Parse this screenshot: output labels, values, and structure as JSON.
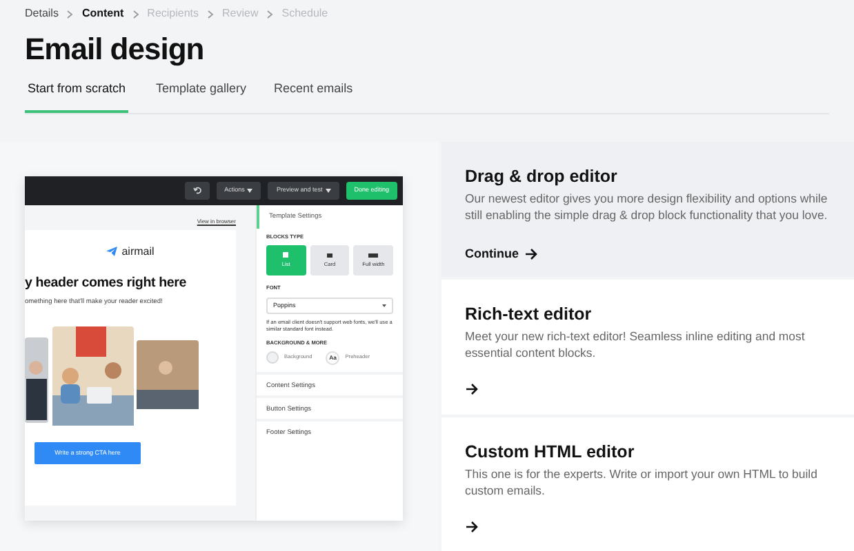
{
  "breadcrumb": [
    {
      "label": "Details",
      "selected": false,
      "disabled": false
    },
    {
      "label": "Content",
      "selected": true,
      "disabled": false
    },
    {
      "label": "Recipients",
      "selected": false,
      "disabled": true
    },
    {
      "label": "Review",
      "selected": false,
      "disabled": true
    },
    {
      "label": "Schedule",
      "selected": false,
      "disabled": true
    }
  ],
  "title": "Email design",
  "tabs": [
    {
      "label": "Start from scratch",
      "selected": true
    },
    {
      "label": "Template gallery",
      "selected": false
    },
    {
      "label": "Recent emails",
      "selected": false
    }
  ],
  "preview": {
    "toolbar": [
      {
        "kind": "undo"
      },
      {
        "kind": "menu",
        "label": "Actions"
      },
      {
        "kind": "menu",
        "label": "Preview and test"
      },
      {
        "kind": "primary",
        "label": "Done editing"
      }
    ],
    "view_link": "View in browser",
    "email": {
      "logo": "airmail",
      "headline": "y header comes right here",
      "subtitle": "omething here that'll make your reader excited!",
      "cta": "Write a strong CTA here"
    },
    "settings": {
      "active_section": "Template Settings",
      "blocks_label": "BLOCKS TYPE",
      "blocks": [
        {
          "label": "List",
          "selected": true
        },
        {
          "label": "Card",
          "selected": false
        },
        {
          "label": "Full width",
          "selected": false
        }
      ],
      "font_label": "FONT",
      "font": "Poppins",
      "font_note": "If an email client doesn't support web fonts, we'll use a similar standard font instead.",
      "background_label": "BACKGROUND & MORE",
      "background": "Background",
      "preheader_badge": "Aa",
      "preheader": "Preheader",
      "sections": [
        "Content Settings",
        "Button Settings",
        "Footer Settings"
      ]
    }
  },
  "options": [
    {
      "title": "Drag & drop editor",
      "description": "Our newest editor gives you more design flexibility and options while still enabling the simple drag & drop block functionality that you love.",
      "link": "Continue",
      "selected": true
    },
    {
      "title": "Rich-text editor",
      "description": "Meet your new rich-text editor! Seamless inline editing and most essential content blocks.",
      "selected": false
    },
    {
      "title": "Custom HTML editor",
      "description": "This one is for the experts. Write or import your own HTML to build custom emails.",
      "selected": false
    }
  ]
}
